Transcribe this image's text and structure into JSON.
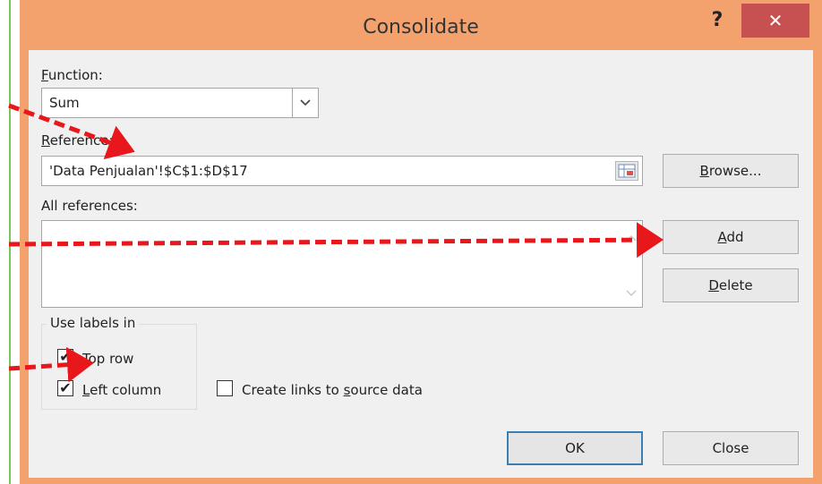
{
  "dialog": {
    "title": "Consolidate",
    "help_label": "?",
    "close_label": "✕"
  },
  "function": {
    "label_accel": "F",
    "label_rest": "unction:",
    "value": "Sum"
  },
  "reference": {
    "label_accel": "R",
    "label_rest": "eference:",
    "value": "'Data Penjualan'!$C$1:$D$17"
  },
  "buttons": {
    "browse_accel": "B",
    "browse_rest": "rowse...",
    "add_accel": "A",
    "add_rest": "dd",
    "delete_accel": "D",
    "delete_rest": "elete",
    "ok": "OK",
    "close": "Close"
  },
  "all_references": {
    "label": "All references:"
  },
  "use_labels": {
    "title": "Use labels in",
    "top_row_accel": "T",
    "top_row_rest": "op row",
    "top_row_checked": true,
    "left_column_accel": "L",
    "left_column_rest": "eft column",
    "left_column_checked": true
  },
  "create_links": {
    "label_before": "Create links to ",
    "label_accel": "s",
    "label_after": "ource data",
    "checked": false
  },
  "colors": {
    "frame": "#f4a26d",
    "close_button": "#c75050",
    "annotation_arrow": "#e8171b"
  }
}
